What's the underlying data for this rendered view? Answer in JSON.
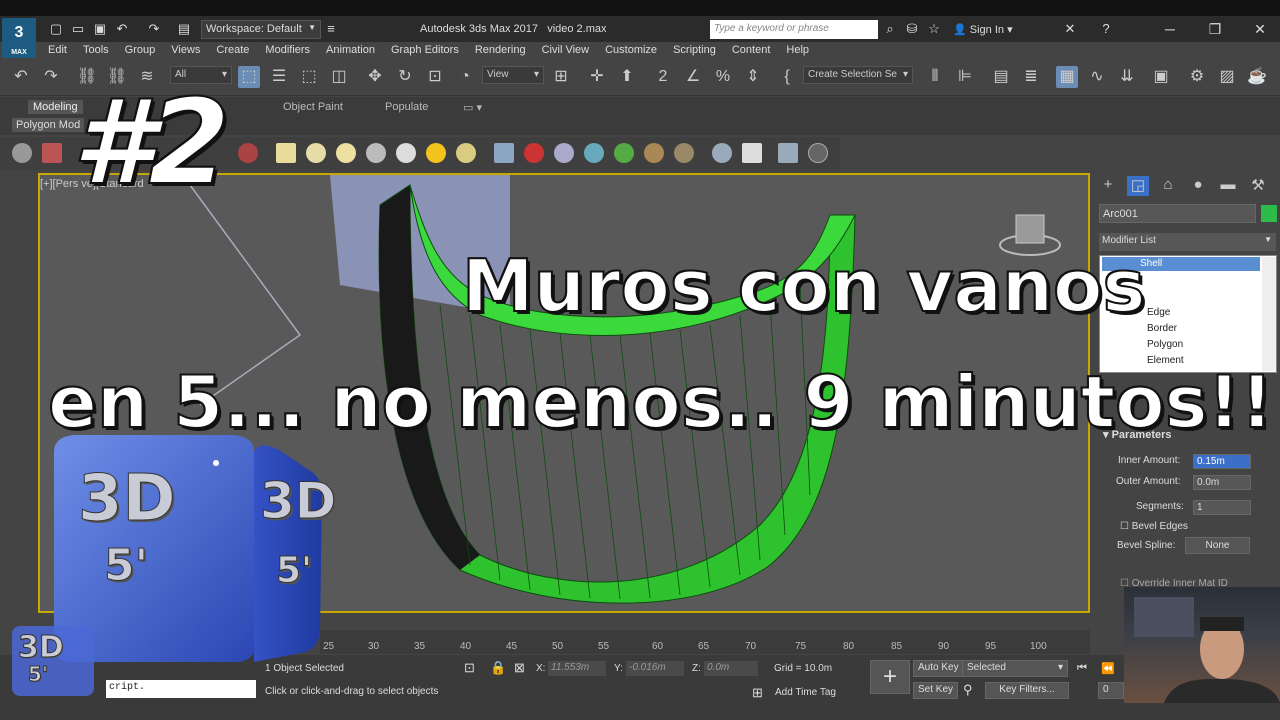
{
  "window": {
    "app_title": "Autodesk 3ds Max 2017",
    "file_name": "video 2.max",
    "logo_label": "MAX",
    "workspace": "Workspace: Default",
    "search_placeholder": "Type a keyword or phrase",
    "sign_in": "Sign In"
  },
  "menu": [
    "Edit",
    "Tools",
    "Group",
    "Views",
    "Create",
    "Modifiers",
    "Animation",
    "Graph Editors",
    "Rendering",
    "Civil View",
    "Customize",
    "Scripting",
    "Content",
    "Help"
  ],
  "toolbar": {
    "filter_all": "All",
    "view_dropdown": "View",
    "selection_set": "Create Selection Se"
  },
  "ribbon": {
    "tabs": [
      "Modeling",
      "Object Paint",
      "Populate"
    ],
    "active_tab": "Modeling",
    "sub_label": "Polygon Mod"
  },
  "viewport": {
    "label": "[+][Pers    ve][Standard"
  },
  "command_panel": {
    "object_name": "Arc001",
    "object_color": "#2dbb4a",
    "modifier_list": "Modifier List",
    "stack": [
      "Shell",
      "Edge",
      "Border",
      "Polygon",
      "Element"
    ],
    "rollout_title": "Parameters",
    "params": {
      "inner_amount_label": "Inner Amount:",
      "inner_amount": "0.15m",
      "outer_amount_label": "Outer Amount:",
      "outer_amount": "0.0m",
      "segments_label": "Segments:",
      "segments": "1",
      "bevel_edges_label": "Bevel Edges",
      "bevel_spline_label": "Bevel Spline:",
      "bevel_spline_value": "None",
      "override_label": "Override Inner Mat ID"
    }
  },
  "timeline": {
    "ticks": [
      "25",
      "30",
      "35",
      "40",
      "45",
      "50",
      "55",
      "60",
      "65",
      "70",
      "75",
      "80",
      "85",
      "90",
      "95",
      "100"
    ]
  },
  "status": {
    "selection": "1 Object Selected",
    "prompt": "Click or click-and-drag to select objects",
    "script": "cript.",
    "x_label": "X:",
    "x_value": "11.553m",
    "y_label": "Y:",
    "y_value": "-0.016m",
    "z_label": "Z:",
    "z_value": "0.0m",
    "grid": "Grid = 10.0m",
    "add_time_tag": "Add Time Tag",
    "auto_key": "Auto Key",
    "set_key": "Set Key",
    "selected": "Selected",
    "key_filters": "Key Filters...",
    "frame": "0"
  },
  "overlay": {
    "episode": "#2",
    "headline_1": "Muros con vanos",
    "headline_2": "en 5... no menos.. 9 minutos!!",
    "badge_text": "3D",
    "badge_sub": "5'"
  }
}
